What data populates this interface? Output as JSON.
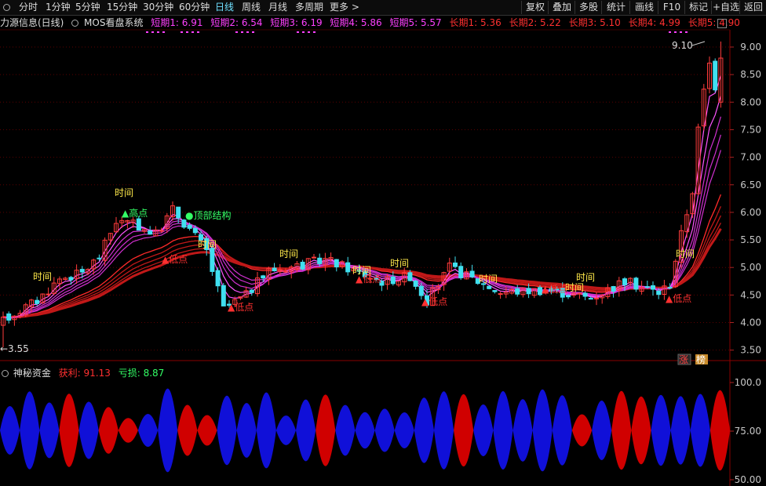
{
  "toolbar": {
    "periods": [
      "分时",
      "1分钟",
      "5分钟",
      "15分钟",
      "30分钟",
      "60分钟",
      "日线",
      "周线",
      "月线",
      "多周期",
      "更多 >"
    ],
    "active_index": 6,
    "right_buttons": [
      "复权",
      "叠加",
      "多股",
      "统计",
      "画线",
      "F10",
      "标记",
      "+自选",
      "返回"
    ]
  },
  "info": {
    "stock_title": "力源信息(日线)",
    "indicator_name": "MOS看盘系统",
    "short": [
      "短期1: 6.91",
      "短期2: 6.54",
      "短期3: 6.19",
      "短期4: 5.86",
      "短期5: 5.57"
    ],
    "long": [
      "长期1: 5.36",
      "长期2: 5.22",
      "长期3: 5.10",
      "长期4: 4.99",
      "长期5: 4.90"
    ]
  },
  "price_axis": {
    "ticks": [
      "9.00",
      "8.50",
      "8.00",
      "7.50",
      "7.00",
      "6.50",
      "6.00",
      "5.50",
      "5.00",
      "4.50",
      "4.00",
      "3.50"
    ],
    "high_marker": "9.10",
    "low_marker": "3.55"
  },
  "annotations": {
    "time": "时间",
    "high": "▲高点",
    "low": "▲低点",
    "top_structure": "●顶部结构"
  },
  "badges": {
    "flag1": "涨",
    "flag2": "榜"
  },
  "sub": {
    "title": "神秘资金",
    "profit": "获利: 91.13",
    "loss": "亏损: 8.87",
    "ticks": [
      "100.0",
      "75.00",
      "50.00"
    ]
  },
  "colors": {
    "up": "#ff3b3b",
    "down": "#40e0f0",
    "ma_short": "#ff40ff",
    "ma_long": "#ff2020",
    "profit": "#d00000",
    "loss": "#1010d8",
    "active_tab": "#6fe0ff"
  }
}
